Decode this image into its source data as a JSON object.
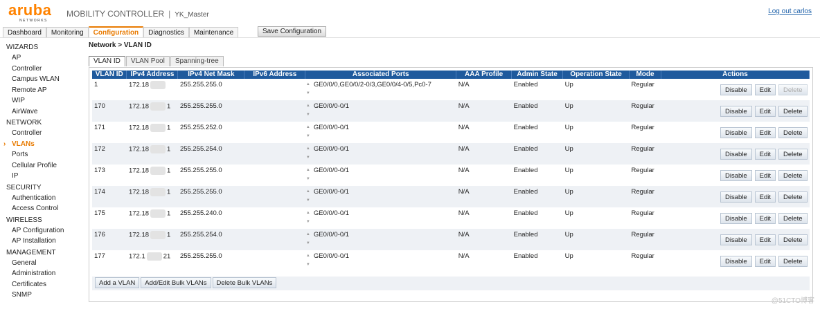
{
  "header": {
    "logo_word": "aruba",
    "logo_sub": "NETWORKS",
    "product": "MOBILITY CONTROLLER",
    "separator": "|",
    "host": "YK_Master",
    "logout": "Log out carlos"
  },
  "tabs": [
    {
      "label": "Dashboard",
      "active": false
    },
    {
      "label": "Monitoring",
      "active": false
    },
    {
      "label": "Configuration",
      "active": true
    },
    {
      "label": "Diagnostics",
      "active": false
    },
    {
      "label": "Maintenance",
      "active": false
    }
  ],
  "save_config": "Save Configuration",
  "sidebar": [
    {
      "type": "head",
      "label": "WIZARDS"
    },
    {
      "type": "item",
      "label": "AP"
    },
    {
      "type": "item",
      "label": "Controller"
    },
    {
      "type": "item",
      "label": "Campus WLAN"
    },
    {
      "type": "item",
      "label": "Remote AP"
    },
    {
      "type": "item",
      "label": "WIP"
    },
    {
      "type": "item",
      "label": "AirWave"
    },
    {
      "type": "head",
      "label": "NETWORK"
    },
    {
      "type": "item",
      "label": "Controller"
    },
    {
      "type": "item",
      "label": "VLANs",
      "active": true
    },
    {
      "type": "item",
      "label": "Ports"
    },
    {
      "type": "item",
      "label": "Cellular Profile"
    },
    {
      "type": "item",
      "label": "IP"
    },
    {
      "type": "head",
      "label": "SECURITY"
    },
    {
      "type": "item",
      "label": "Authentication"
    },
    {
      "type": "item",
      "label": "Access Control"
    },
    {
      "type": "head",
      "label": "WIRELESS"
    },
    {
      "type": "item",
      "label": "AP Configuration"
    },
    {
      "type": "item",
      "label": "AP Installation"
    },
    {
      "type": "head",
      "label": "MANAGEMENT"
    },
    {
      "type": "item",
      "label": "General"
    },
    {
      "type": "item",
      "label": "Administration"
    },
    {
      "type": "item",
      "label": "Certificates"
    },
    {
      "type": "item",
      "label": "SNMP"
    }
  ],
  "breadcrumb": "Network > VLAN ID",
  "subtabs": [
    {
      "label": "VLAN ID",
      "active": true
    },
    {
      "label": "VLAN Pool",
      "active": false
    },
    {
      "label": "Spanning-tree",
      "active": false
    }
  ],
  "table": {
    "columns": [
      "VLAN ID",
      "IPv4 Address",
      "IPv4 Net Mask",
      "IPv6 Address",
      "Associated Ports",
      "AAA Profile",
      "Admin State",
      "Operation State",
      "Mode",
      "Actions"
    ],
    "rows": [
      {
        "vlan": "1",
        "ip_prefix": "172.18",
        "ip_suffix": "",
        "mask": "255.255.255.0",
        "ipv6": "",
        "ports": "GE0/0/0,GE0/0/2-0/3,GE0/0/4-0/5,Pc0-7",
        "aaa": "N/A",
        "admin": "Enabled",
        "oper": "Up",
        "mode": "Regular",
        "delete_disabled": true
      },
      {
        "vlan": "170",
        "ip_prefix": "172.18",
        "ip_suffix": "1",
        "mask": "255.255.255.0",
        "ipv6": "",
        "ports": "GE0/0/0-0/1",
        "aaa": "N/A",
        "admin": "Enabled",
        "oper": "Up",
        "mode": "Regular",
        "delete_disabled": false
      },
      {
        "vlan": "171",
        "ip_prefix": "172.18",
        "ip_suffix": "1",
        "mask": "255.255.252.0",
        "ipv6": "",
        "ports": "GE0/0/0-0/1",
        "aaa": "N/A",
        "admin": "Enabled",
        "oper": "Up",
        "mode": "Regular",
        "delete_disabled": false
      },
      {
        "vlan": "172",
        "ip_prefix": "172.18",
        "ip_suffix": "1",
        "mask": "255.255.254.0",
        "ipv6": "",
        "ports": "GE0/0/0-0/1",
        "aaa": "N/A",
        "admin": "Enabled",
        "oper": "Up",
        "mode": "Regular",
        "delete_disabled": false
      },
      {
        "vlan": "173",
        "ip_prefix": "172.18",
        "ip_suffix": "1",
        "mask": "255.255.255.0",
        "ipv6": "",
        "ports": "GE0/0/0-0/1",
        "aaa": "N/A",
        "admin": "Enabled",
        "oper": "Up",
        "mode": "Regular",
        "delete_disabled": false
      },
      {
        "vlan": "174",
        "ip_prefix": "172.18",
        "ip_suffix": "1",
        "mask": "255.255.255.0",
        "ipv6": "",
        "ports": "GE0/0/0-0/1",
        "aaa": "N/A",
        "admin": "Enabled",
        "oper": "Up",
        "mode": "Regular",
        "delete_disabled": false
      },
      {
        "vlan": "175",
        "ip_prefix": "172.18",
        "ip_suffix": "1",
        "mask": "255.255.240.0",
        "ipv6": "",
        "ports": "GE0/0/0-0/1",
        "aaa": "N/A",
        "admin": "Enabled",
        "oper": "Up",
        "mode": "Regular",
        "delete_disabled": false
      },
      {
        "vlan": "176",
        "ip_prefix": "172.18",
        "ip_suffix": "1",
        "mask": "255.255.254.0",
        "ipv6": "",
        "ports": "GE0/0/0-0/1",
        "aaa": "N/A",
        "admin": "Enabled",
        "oper": "Up",
        "mode": "Regular",
        "delete_disabled": false
      },
      {
        "vlan": "177",
        "ip_prefix": "172.1",
        "ip_suffix": "21",
        "mask": "255.255.255.0",
        "ipv6": "",
        "ports": "GE0/0/0-0/1",
        "aaa": "N/A",
        "admin": "Enabled",
        "oper": "Up",
        "mode": "Regular",
        "delete_disabled": false
      }
    ]
  },
  "row_actions": {
    "disable": "Disable",
    "edit": "Edit",
    "delete": "Delete"
  },
  "bottom_buttons": [
    "Add a VLAN",
    "Add/Edit Bulk VLANs",
    "Delete Bulk VLANs"
  ],
  "watermark": "@51CTO博客",
  "colors": {
    "accent": "#ff8300",
    "table_header": "#1f5a9d",
    "link": "#1a5ea8"
  }
}
